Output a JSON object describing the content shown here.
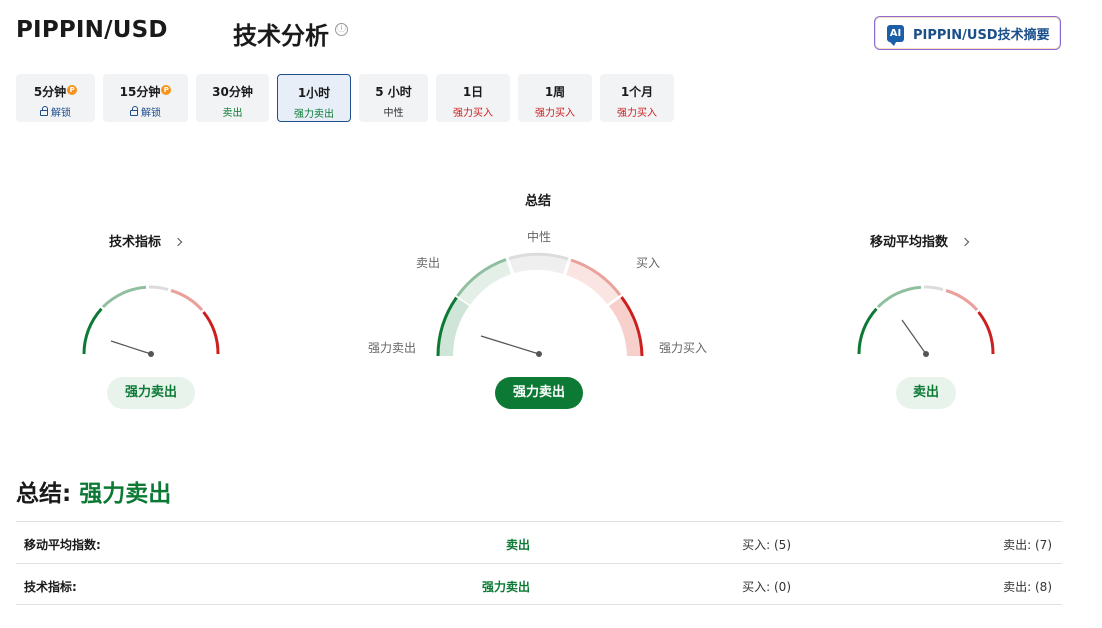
{
  "header": {
    "pair": "PIPPIN/USD",
    "section_title": "技术分析",
    "info_icon": "ⓘ",
    "ai_badge": "AI",
    "ai_button_label": "PIPPIN/USD技术摘要"
  },
  "tabs": [
    {
      "label": "5分钟",
      "pro_icon": "P",
      "status": "解锁",
      "locked": true
    },
    {
      "label": "15分钟",
      "pro_icon": "P",
      "status": "解锁",
      "locked": true
    },
    {
      "label": "30分钟",
      "status": "卖出"
    },
    {
      "label": "1小时",
      "status": "强力卖出",
      "active": true
    },
    {
      "label": "5 小时",
      "status": "中性"
    },
    {
      "label": "1日",
      "status": "强力买入"
    },
    {
      "label": "1周",
      "status": "强力买入"
    },
    {
      "label": "1个月",
      "status": "强力买入"
    }
  ],
  "gauges": {
    "technical": {
      "title": "技术指标",
      "result": "强力卖出"
    },
    "summary": {
      "title": "总结",
      "result": "强力卖出",
      "labels": {
        "neutral": "中性",
        "sell": "卖出",
        "buy": "买入",
        "strong_sell": "强力卖出",
        "strong_buy": "强力买入"
      }
    },
    "moving_average": {
      "title": "移动平均指数",
      "result": "卖出"
    }
  },
  "summary": {
    "label": "总结:",
    "value": "强力卖出"
  },
  "table": [
    {
      "name": "移动平均指数:",
      "signal": "卖出",
      "buy": "买入: (5)",
      "sell": "卖出: (7)"
    },
    {
      "name": "技术指标:",
      "signal": "强力卖出",
      "buy": "买入: (0)",
      "sell": "卖出: (8)"
    }
  ],
  "colors": {
    "sell_green": "#0c7a35",
    "buy_red": "#cc1f1f",
    "accent_blue": "#1f4e8c"
  }
}
